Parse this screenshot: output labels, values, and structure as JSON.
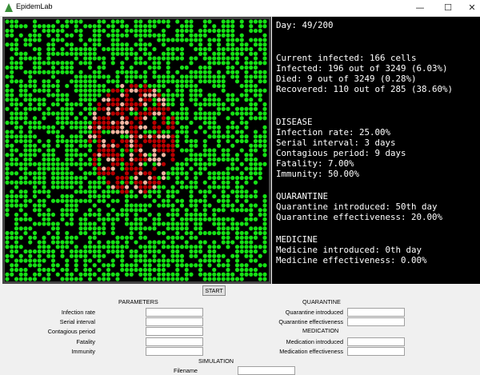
{
  "window": {
    "title": "EpidemLab",
    "minimize": "—",
    "maximize": "☐",
    "close": "✕"
  },
  "colors": {
    "healthy": "#15e115",
    "infected": "#b80000",
    "recovered": "#f0b5a0",
    "empty": "#000000",
    "died": "#000000"
  },
  "stats": {
    "day": "Day: 49/200",
    "current": "Current infected: 166 cells",
    "infected": "Infected: 196 out of 3249 (6.03%)",
    "died": "Died: 9 out of 3249 (0.28%)",
    "recovered": "Recovered: 110 out of 285 (38.60%)",
    "disease_header": "DISEASE",
    "infection_rate": "Infection rate: 25.00%",
    "serial_interval": "Serial interval: 3 days",
    "contagious": "Contagious period: 9 days",
    "fatality": "Fatality: 7.00%",
    "immunity": "Immunity: 50.00%",
    "quarantine_header": "QUARANTINE",
    "quarantine_intro": "Quarantine introduced: 50th day",
    "quarantine_eff": "Quarantine effectiveness: 20.00%",
    "medicine_header": "MEDICINE",
    "medicine_intro": "Medicine introduced: 0th day",
    "medicine_eff": "Medicine effectiveness: 0.00%"
  },
  "controls": {
    "start": "START",
    "parameters_header": "PARAMETERS",
    "quarantine_header": "QUARANTINE",
    "medication_header": "MEDICATION",
    "simulation_header": "SIMULATION",
    "infection_rate": {
      "label": "Infection rate",
      "value": ""
    },
    "serial_interval": {
      "label": "Serial interval",
      "value": ""
    },
    "contagious_period": {
      "label": "Contagious period",
      "value": ""
    },
    "fatality": {
      "label": "Fatality",
      "value": ""
    },
    "immunity": {
      "label": "Immunity",
      "value": ""
    },
    "quarantine_introduced": {
      "label": "Quarantine introduced",
      "value": ""
    },
    "quarantine_effectiveness": {
      "label": "Quarantine effectiveness",
      "value": ""
    },
    "medication_introduced": {
      "label": "Medication introduced",
      "value": ""
    },
    "medication_effectiveness": {
      "label": "Medication effectiveness",
      "value": ""
    },
    "filename": {
      "label": "Filename",
      "value": ""
    }
  }
}
